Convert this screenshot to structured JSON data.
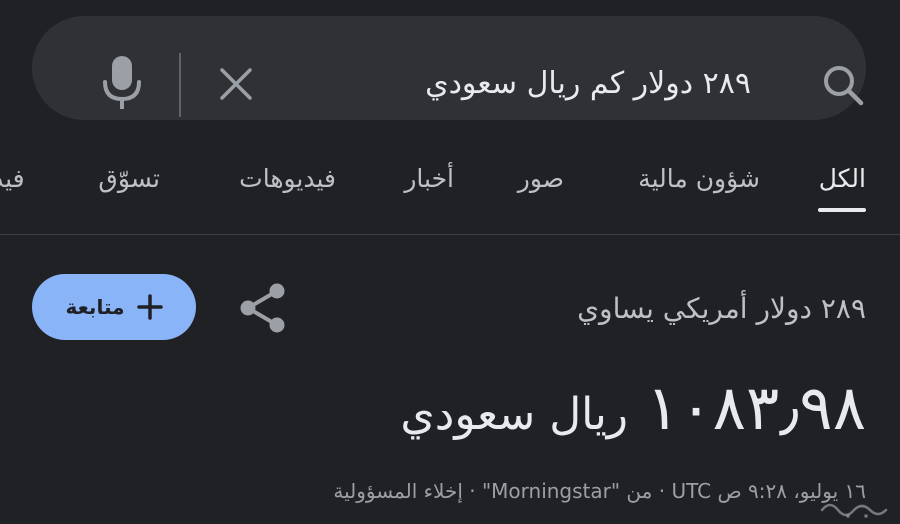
{
  "search": {
    "query": "٢٨٩ دولار كم ريال سعودي",
    "icons": [
      "mic-icon",
      "clear-icon",
      "search-icon"
    ]
  },
  "tabs": [
    {
      "label": "الكل",
      "active": true
    },
    {
      "label": "شؤون مالية"
    },
    {
      "label": "صور"
    },
    {
      "label": "أخبار"
    },
    {
      "label": "فيديوهات"
    },
    {
      "label": "تسوّق"
    },
    {
      "label": "فيد"
    }
  ],
  "converter": {
    "follow_label": "متابعة",
    "equals_text": "٢٨٩ دولار أمريكي يساوي",
    "result_amount": "١٠٨٣٫٩٨",
    "result_currency": "ريال سعودي",
    "meta": "١٦ يوليو، ٩:٢٨ ص UTC · من \"Morningstar\" · إخلاء المسؤولية"
  },
  "colors": {
    "background": "#202124",
    "search_bar": "#303134",
    "follow_button": "#8ab4f8"
  }
}
